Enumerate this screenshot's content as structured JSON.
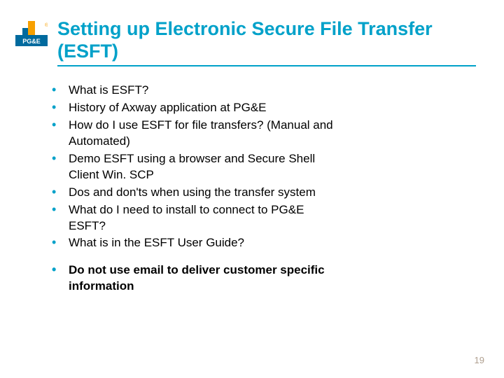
{
  "logo": {
    "brand": "PG&E"
  },
  "title": "Setting up Electronic Secure File Transfer (ESFT)",
  "bullets_main": [
    "What is ESFT?",
    "History of Axway application at PG&E",
    "How do I use ESFT for file transfers? (Manual and Automated)",
    "Demo ESFT using a browser and Secure Shell Client Win. SCP",
    "Dos and don'ts when using the transfer system",
    "What do I need to install to connect to PG&E ESFT?",
    "What is in the ESFT User Guide?"
  ],
  "bullets_emphasis": [
    "Do not use email to deliver customer specific information"
  ],
  "page_number": "19",
  "colors": {
    "accent": "#00a1c9"
  }
}
